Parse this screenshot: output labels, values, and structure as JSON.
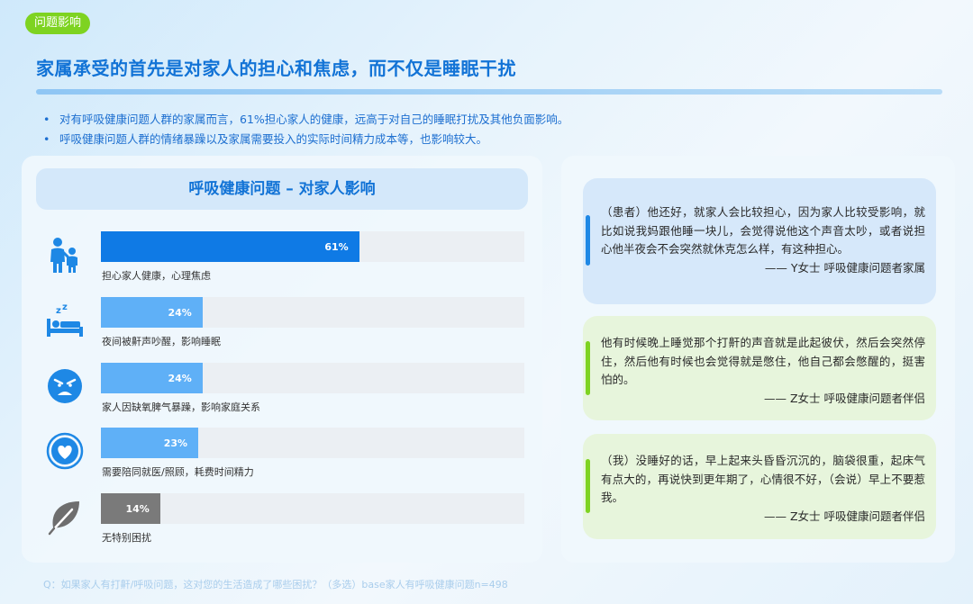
{
  "tag": "问题影响",
  "title": "家属承受的首先是对家人的担心和焦虑，而不仅是睡眠干扰",
  "bullets": [
    "对有呼吸健康问题人群的家属而言，61%担心家人的健康，远高于对自己的睡眠打扰及其他负面影响。",
    "呼吸健康问题人群的情绪暴躁以及家属需要投入的实际时间精力成本等，也影响较大。"
  ],
  "chart_data": {
    "type": "bar",
    "title": "呼吸健康问题 – 对家人影响",
    "orientation": "horizontal",
    "unit": "%",
    "categories": [
      "担心家人健康，心理焦虑",
      "夜间被鼾声吵醒，影响睡眠",
      "家人因缺氧脾气暴躁，影响家庭关系",
      "需要陪同就医/照顾，耗费时间精力",
      "无特别困扰"
    ],
    "values": [
      61,
      24,
      24,
      23,
      14
    ],
    "value_labels": [
      "61%",
      "24%",
      "24%",
      "23%",
      "14%"
    ],
    "bar_colors": [
      "#0f7ae5",
      "#5fb0f7",
      "#5fb0f7",
      "#5fb0f7",
      "#7a7a7a"
    ],
    "icons": [
      "family-icon",
      "sleep-icon",
      "angry-face-icon",
      "heart-icon",
      "leaf-icon"
    ],
    "xlim": [
      0,
      100
    ]
  },
  "quotes": [
    {
      "text": "（患者）他还好，就家人会比较担心，因为家人比较受影响，就比如说我妈跟他睡一块儿，会觉得说他这个声音太吵，或者说担心他半夜会不会突然就休克怎么样，有这种担心。",
      "source": "—— Y女士 呼吸健康问题者家属"
    },
    {
      "text": "他有时候晚上睡觉那个打鼾的声音就是此起彼伏，然后会突然停住，然后他有时候也会觉得就是憋住，他自己都会憋醒的，挺害怕的。",
      "source": "—— Z女士 呼吸健康问题者伴侣"
    },
    {
      "text": "（我）没睡好的话，早上起来头昏昏沉沉的，脑袋很重，起床气有点大的，再说快到更年期了，心情很不好，（会说）早上不要惹我。",
      "source": "—— Z女士 呼吸健康问题者伴侣"
    }
  ],
  "footnote": "Q：如果家人有打鼾/呼吸问题，这对您的生活造成了哪些困扰？（多选）base家人有呼吸健康问题n=498",
  "colors": {
    "accent_blue": "#1273d6",
    "accent_green": "#7ed321",
    "icon_blue": "#1e88e5"
  }
}
